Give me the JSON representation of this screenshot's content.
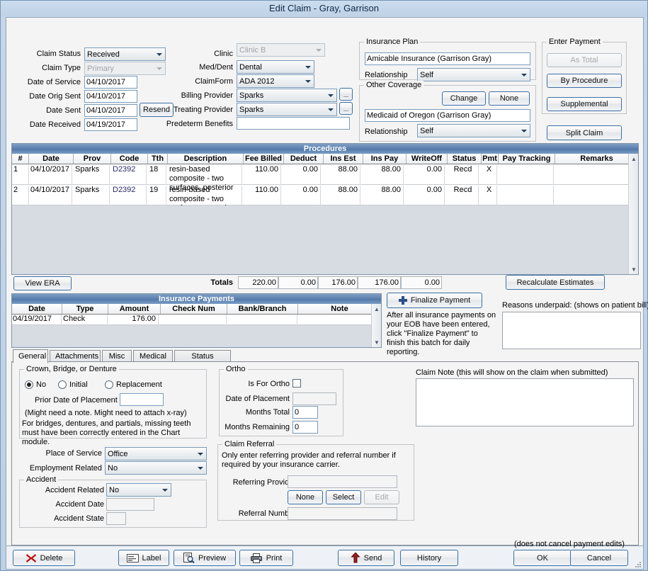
{
  "window": {
    "title": "Edit Claim - Gray, Garrison"
  },
  "claim": {
    "status_label": "Claim Status",
    "status_value": "Received",
    "type_label": "Claim Type",
    "type_value": "Primary",
    "date_service_label": "Date of Service",
    "date_service_value": "04/10/2017",
    "date_orig_sent_label": "Date Orig Sent",
    "date_orig_sent_value": "04/10/2017",
    "date_sent_label": "Date Sent",
    "date_sent_value": "04/10/2017",
    "resend_label": "Resend",
    "date_received_label": "Date Received",
    "date_received_value": "04/19/2017"
  },
  "clinicarea": {
    "clinic_label": "Clinic",
    "clinic_value": "Clinic B",
    "meddent_label": "Med/Dent",
    "meddent_value": "Dental",
    "claimform_label": "ClaimForm",
    "claimform_value": "ADA 2012",
    "billing_provider_label": "Billing Provider",
    "billing_provider_value": "Sparks",
    "treating_provider_label": "Treating Provider",
    "treating_provider_value": "Sparks",
    "predeterm_label": "Predeterm Benefits",
    "predeterm_value": "",
    "ellipsis": "..."
  },
  "insurance_plan": {
    "caption": "Insurance Plan",
    "plan_value": "Amicable Insurance (Garrison Gray)",
    "relationship_label": "Relationship",
    "relationship_value": "Self"
  },
  "other_coverage": {
    "caption": "Other Coverage",
    "change_label": "Change",
    "none_label": "None",
    "plan_value": "Medicaid of Oregon (Garrison Gray)",
    "relationship_label": "Relationship",
    "relationship_value": "Self"
  },
  "enter_payment": {
    "caption": "Enter Payment",
    "as_total_label": "As Total",
    "by_procedure_label": "By Procedure",
    "supplemental_label": "Supplemental",
    "split_claim_label": "Split Claim"
  },
  "procedures": {
    "title": "Procedures",
    "columns": [
      "#",
      "Date",
      "Prov",
      "Code",
      "Tth",
      "Description",
      "Fee Billed",
      "Deduct",
      "Ins Est",
      "Ins Pay",
      "WriteOff",
      "Status",
      "Pmt",
      "Pay Tracking",
      "Remarks"
    ],
    "rows": [
      {
        "num": "1",
        "date": "04/10/2017",
        "prov": "Sparks",
        "code": "D2392",
        "tth": "18",
        "description": "resin-based composite - two surfaces, posterior",
        "fee_billed": "110.00",
        "deduct": "0.00",
        "ins_est": "88.00",
        "ins_pay": "88.00",
        "writeoff": "0.00",
        "status": "Recd",
        "pmt": "X",
        "pay_tracking": "",
        "remarks": ""
      },
      {
        "num": "2",
        "date": "04/10/2017",
        "prov": "Sparks",
        "code": "D2392",
        "tth": "19",
        "description": "resin-based composite - two surfaces, posterior",
        "fee_billed": "110.00",
        "deduct": "0.00",
        "ins_est": "88.00",
        "ins_pay": "88.00",
        "writeoff": "0.00",
        "status": "Recd",
        "pmt": "X",
        "pay_tracking": "",
        "remarks": ""
      }
    ],
    "view_era_label": "View ERA",
    "totals_label": "Totals",
    "totals": [
      "220.00",
      "0.00",
      "176.00",
      "176.00",
      "0.00"
    ],
    "recalculate_label": "Recalculate Estimates"
  },
  "insurance_payments": {
    "title": "Insurance Payments",
    "columns": [
      "Date",
      "Type",
      "Amount",
      "Check Num",
      "Bank/Branch",
      "Note"
    ],
    "rows": [
      {
        "date": "04/19/2017",
        "type": "Check",
        "amount": "176.00",
        "check_num": "",
        "bank_branch": "",
        "note": ""
      }
    ],
    "finalize_label": "Finalize Payment",
    "finalize_help": "After all insurance payments on your EOB have been entered, click \"Finalize Payment\" to finish this batch for daily reporting.",
    "reasons_label": "Reasons underpaid:  (shows on patient bill)",
    "reasons_value": ""
  },
  "tabs": [
    {
      "label": "General",
      "active": true
    },
    {
      "label": "Attachments",
      "active": false
    },
    {
      "label": "Misc",
      "active": false
    },
    {
      "label": "Medical",
      "active": false
    },
    {
      "label": "Status History",
      "active": false
    }
  ],
  "crown": {
    "caption": "Crown, Bridge, or Denture",
    "option_no": "No",
    "option_initial": "Initial",
    "option_replacement": "Replacement",
    "selected": "No",
    "prior_date_label": "Prior Date of Placement",
    "prior_date_value": "",
    "hint1": "(Might need a note. Might need to attach x-ray)",
    "hint2": "For bridges, dentures, and partials, missing teeth must have been correctly entered in the Chart module."
  },
  "ortho": {
    "caption": "Ortho",
    "is_for_ortho_label": "Is For Ortho",
    "is_for_ortho_checked": false,
    "date_placement_label": "Date of Placement",
    "date_placement_value": "",
    "months_total_label": "Months Total",
    "months_total_value": "0",
    "months_remaining_label": "Months Remaining",
    "months_remaining_value": "0"
  },
  "claim_note": {
    "label": "Claim Note (this will show on the claim when submitted)",
    "value": ""
  },
  "service": {
    "place_label": "Place of Service",
    "place_value": "Office",
    "employment_label": "Employment Related",
    "employment_value": "No"
  },
  "accident": {
    "caption": "Accident",
    "related_label": "Accident Related",
    "related_value": "No",
    "date_label": "Accident Date",
    "date_value": "",
    "state_label": "Accident State",
    "state_value": ""
  },
  "referral": {
    "caption": "Claim Referral",
    "hint": "Only enter referring provider and referral number if required by your insurance carrier.",
    "provider_label": "Referring Provider",
    "provider_value": "",
    "none_label": "None",
    "select_label": "Select",
    "edit_label": "Edit",
    "number_label": "Referral Number",
    "number_value": ""
  },
  "footer": {
    "delete_label": "Delete",
    "label_label": "Label",
    "preview_label": "Preview",
    "print_label": "Print",
    "send_label": "Send",
    "history_label": "History",
    "ok_label": "OK",
    "cancel_label": "Cancel",
    "cancel_hint": "(does not cancel payment edits)"
  },
  "colors": {
    "grid_header": "#5179a9",
    "accent_border": "#3c6ea5",
    "window_bg": "#bdd0e4"
  }
}
